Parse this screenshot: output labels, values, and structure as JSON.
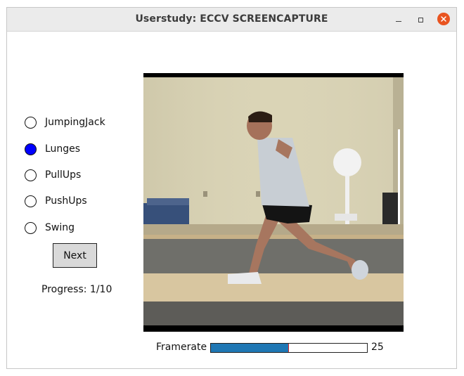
{
  "window": {
    "title": "Userstudy: ECCV SCREENCAPTURE"
  },
  "options": [
    {
      "label": "JumpingJack",
      "selected": false
    },
    {
      "label": "Lunges",
      "selected": true
    },
    {
      "label": "PullUps",
      "selected": false
    },
    {
      "label": "PushUps",
      "selected": false
    },
    {
      "label": "Swing",
      "selected": false
    }
  ],
  "next_button": {
    "label": "Next"
  },
  "progress": {
    "text": "Progress: 1/10"
  },
  "framerate": {
    "label": "Framerate",
    "value_text": "25",
    "fill_fraction": 0.5
  },
  "colors": {
    "selected_radio": "#0000ff",
    "slider_fill": "#1f77b4",
    "slider_marker": "#d62728",
    "close_button": "#e95420"
  },
  "icons": {
    "close": "close-icon",
    "minimize": "minimize-icon",
    "maximize": "maximize-icon"
  }
}
